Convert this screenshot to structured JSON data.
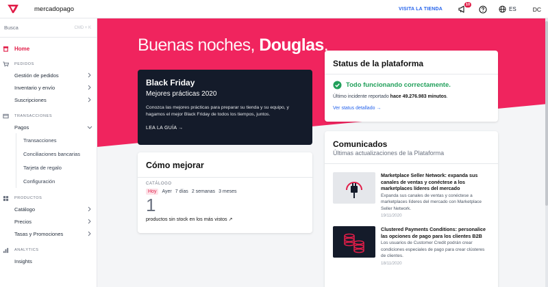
{
  "topbar": {
    "brand": "mercadopago",
    "visit_store": "VISITA LA TIENDA",
    "notif_count": "10",
    "language": "ES",
    "user_initials": "DC",
    "accent": "#e11d48"
  },
  "sidebar": {
    "search_placeholder": "Busca",
    "search_hint": "CMD + K",
    "home": "Home",
    "sections": {
      "pedidos": "PEDIDOS",
      "transacciones": "TRANSACCIONES",
      "productos": "PRODUCTOS",
      "analytics": "ANALYTICS"
    },
    "pedidos_items": [
      "Gestión de pedidos",
      "Inventario y envío",
      "Suscripciones"
    ],
    "pagos": "Pagos",
    "pagos_items": [
      "Transacciones",
      "Conciliaciones bancarias",
      "Tarjeta de regalo",
      "Configuración"
    ],
    "productos_items": [
      "Catálogo",
      "Precios",
      "Tasas y Promociones"
    ],
    "analytics_items": [
      "Insights"
    ]
  },
  "main": {
    "greeting_prefix": "Buenas noches,",
    "greeting_name": "Douglas",
    "greeting_suffix": ".",
    "black_friday": {
      "title": "Black Friday",
      "subtitle": "Mejores prácticas 2020",
      "description": "Conozca las mejores prácticas para preparar su tienda y su equipo, y hagamos el mejor Black Friday de todos los tiempos, juntos.",
      "link": "LEA LA GUÍA →"
    },
    "como_mejorar": {
      "title": "Cómo mejorar",
      "category": "CATÁLOGO",
      "tabs": [
        "Hoy",
        "Ayer",
        "7 días",
        "2 semanas",
        "3 meses"
      ],
      "value": "1",
      "description": "productos sin stock en los más vistos ↗"
    },
    "status": {
      "title": "Status de la plataforma",
      "ok_text": "Todo funcionando correctamente.",
      "last_prefix": "Último incidente reportado",
      "last_value": "hace 49.276.983 minutos",
      "last_suffix": ".",
      "link": "Ver status detallado →",
      "ok_color": "#22a05b"
    },
    "comunicados": {
      "title": "Comunicados",
      "subtitle": "Últimas actualizaciones de la Plataforma",
      "items": [
        {
          "title": "Marketplace Seller Network: expanda sus canales de ventas y conéctese a los marketplaces líderes del mercado",
          "body": "Expanda sus canales de ventas y conéctese a marketplaces líderes del mercado con Marketplace Seller Network.",
          "date": "19/11/2020",
          "icon": "plug-icon"
        },
        {
          "title": "Clustered Payments Conditions: personalice las opciones de pago para los clientes B2B",
          "body": "Los usuarios de Customer Credit podrán crear condiciones especiales de pago para crear clústeres de clientes.",
          "date": "18/11/2020",
          "icon": "coins-icon"
        }
      ]
    }
  }
}
